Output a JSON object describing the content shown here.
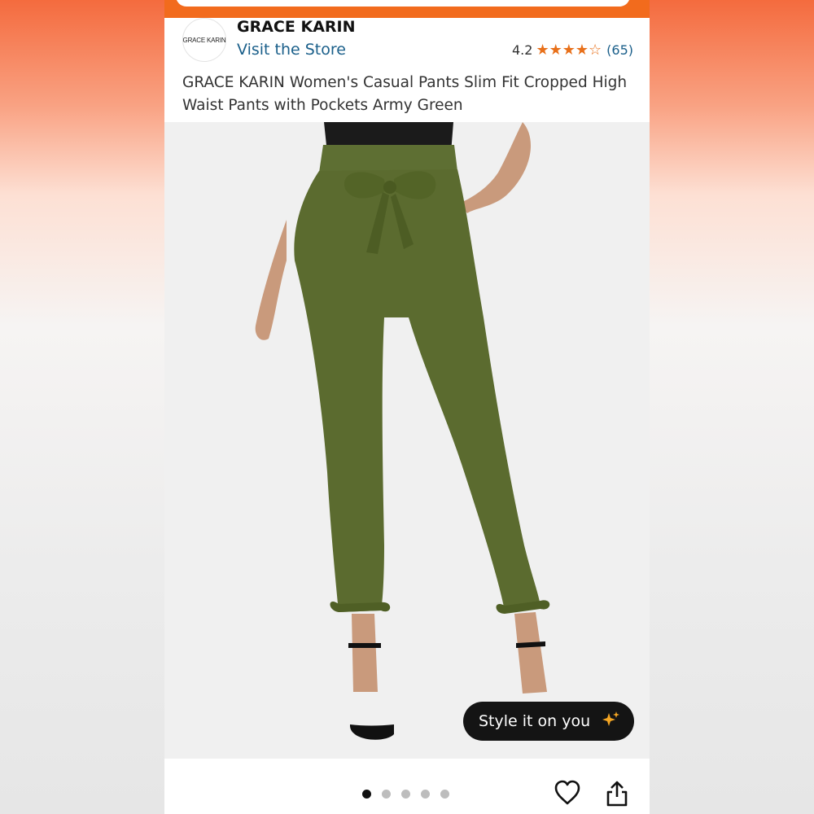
{
  "brand": {
    "logo_text": "GRACE KARIN",
    "name": "GRACE KARIN",
    "visit_store": "Visit the Store"
  },
  "rating": {
    "value": "4.2",
    "stars": 4.2,
    "count": "(65)"
  },
  "product": {
    "title": "GRACE KARIN Women's Casual Pants Slim Fit Cropped High Waist Pants with Pockets Army Green"
  },
  "image_carousel": {
    "total": 5,
    "active_index": 0
  },
  "style_button": {
    "label": "Style it on you",
    "icon": "sparkle-icon"
  },
  "actions": {
    "favorite_icon": "heart-icon",
    "share_icon": "share-icon"
  },
  "colors": {
    "top_bar": "#f26b1d",
    "link": "#1a5f8a",
    "star": "#e8701a",
    "pants": "#5b6b2f"
  }
}
